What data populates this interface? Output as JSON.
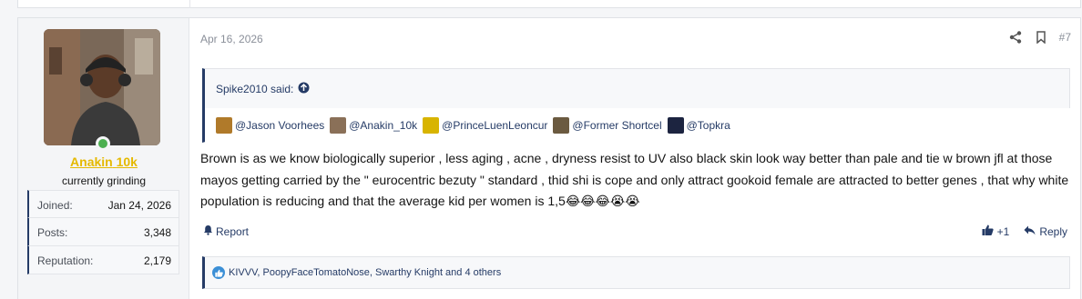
{
  "post": {
    "date": "Apr 16, 2026",
    "number": "#7",
    "author": {
      "name_part1": "Anakin",
      "name_part2": "10k",
      "title": "currently grinding",
      "online": true
    },
    "stats": [
      {
        "label": "Joined:",
        "value": "Jan 24, 2026"
      },
      {
        "label": "Posts:",
        "value": "3,348"
      },
      {
        "label": "Reputation:",
        "value": "2,179"
      }
    ],
    "quote": {
      "author_said": "Spike2010 said:",
      "mentions": [
        {
          "text": "@Jason Voorhees",
          "color": "#b07a2a"
        },
        {
          "text": "@Anakin_10k",
          "color": "#8a7058"
        },
        {
          "text": "@PrinceLuenLeoncur",
          "color": "#d8b400"
        },
        {
          "text": "@Former Shortcel",
          "color": "#6b5a40"
        },
        {
          "text": "@Topkra",
          "color": "#1c2440"
        }
      ]
    },
    "body": "Brown is as we know biologically superior , less aging , acne , dryness resist to UV also black skin look way better than pale and tie w brown jfl at those mayos getting carried by the \" eurocentric bezuty \" standard , thid shi is cope and only attract gookoid female are attracted to better genes , that why white population is reducing and that the average kid per women is 1,5",
    "body_emojis": "😂😂😂😭😭",
    "footer": {
      "report_label": "Report",
      "like_count": "+1",
      "reply_label": "Reply"
    },
    "reactions_text": "KIVVV, PoopyFaceTomatoNose, Swarthy Knight and 4 others"
  },
  "colors": {
    "accent": "#253b66",
    "username": "#e5b900",
    "online": "#4caf50"
  }
}
